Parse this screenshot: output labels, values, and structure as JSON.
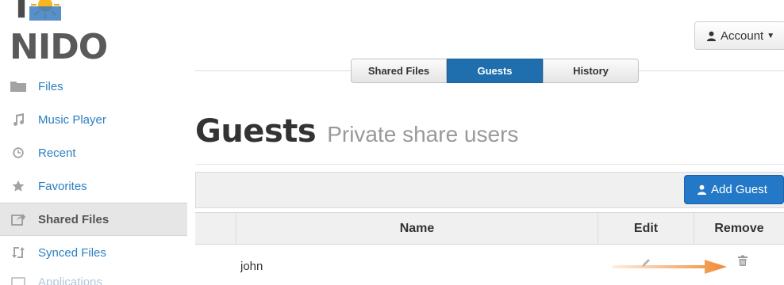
{
  "app": {
    "logo_text": "T NIDO"
  },
  "header": {
    "account_label": "Account"
  },
  "sidebar": {
    "items": [
      {
        "label": "Files",
        "icon": "folder-icon"
      },
      {
        "label": "Music Player",
        "icon": "music-note-icon"
      },
      {
        "label": "Recent",
        "icon": "clock-icon"
      },
      {
        "label": "Favorites",
        "icon": "star-icon"
      },
      {
        "label": "Shared Files",
        "icon": "share-icon",
        "active": true
      },
      {
        "label": "Synced Files",
        "icon": "sync-icon"
      },
      {
        "label": "Applications",
        "icon": "apps-icon"
      }
    ]
  },
  "tabs": [
    {
      "label": "Shared Files"
    },
    {
      "label": "Guests",
      "active": true
    },
    {
      "label": "History"
    }
  ],
  "page": {
    "title": "Guests",
    "subtitle": "Private share users"
  },
  "toolbar": {
    "add_guest_label": "Add Guest"
  },
  "table": {
    "columns": [
      "",
      "Name",
      "Edit",
      "Remove"
    ],
    "rows": [
      {
        "name": "john"
      }
    ]
  },
  "colors": {
    "accent": "#2378c8",
    "tab_active": "#1f6fae",
    "link": "#2a7fc1",
    "annotation_arrow": "#f08a35"
  }
}
